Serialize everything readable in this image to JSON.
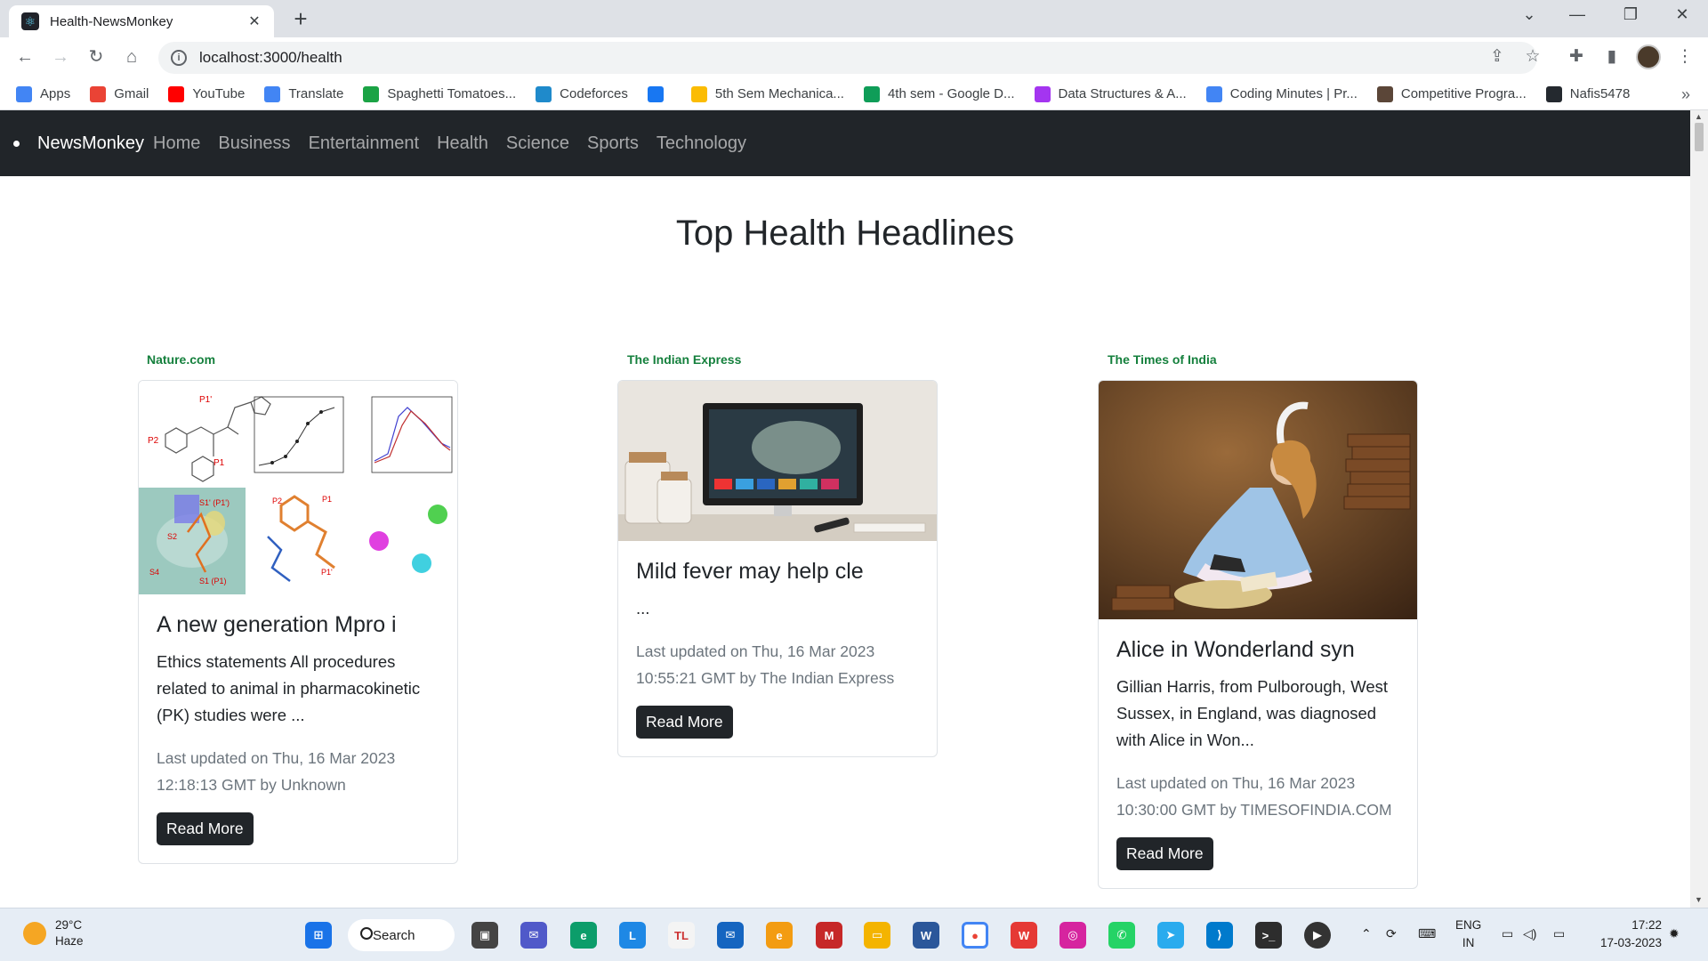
{
  "browser": {
    "tab_title": "Health-NewsMonkey",
    "tab_close": "✕",
    "new_tab": "+",
    "url": "localhost:3000/health",
    "bookmarks": [
      {
        "label": "Apps",
        "icon": "apps-grid-icon",
        "color": "#4285f4"
      },
      {
        "label": "Gmail",
        "icon": "gmail-icon",
        "color": "#ea4335"
      },
      {
        "label": "YouTube",
        "icon": "youtube-icon",
        "color": "#ff0000"
      },
      {
        "label": "Translate",
        "icon": "translate-icon",
        "color": "#4285f4"
      },
      {
        "label": "Spaghetti Tomatoes...",
        "icon": "px-icon",
        "color": "#1ba345"
      },
      {
        "label": "Codeforces",
        "icon": "codeforces-icon",
        "color": "#1f8acb"
      },
      {
        "label": "",
        "icon": "facebook-icon",
        "color": "#1877f2"
      },
      {
        "label": "5th Sem Mechanica...",
        "icon": "google-drive-icon",
        "color": "#fbbc04"
      },
      {
        "label": "4th sem - Google D...",
        "icon": "google-drive-icon",
        "color": "#0f9d58"
      },
      {
        "label": "Data Structures & A...",
        "icon": "udemy-icon",
        "color": "#a435f0"
      },
      {
        "label": "Coding Minutes | Pr...",
        "icon": "docs-icon",
        "color": "#4285f4"
      },
      {
        "label": "Competitive Progra...",
        "icon": "cc-icon",
        "color": "#5b4638"
      },
      {
        "label": "Nafis5478",
        "icon": "github-icon",
        "color": "#24292f"
      }
    ]
  },
  "app": {
    "brand": "NewsMonkey",
    "nav": [
      "Home",
      "Business",
      "Entertainment",
      "Health",
      "Science",
      "Sports",
      "Technology"
    ],
    "heading": "Top Health Headlines",
    "read_more": "Read More",
    "articles": [
      {
        "source": "Nature.com",
        "title": "A new generation Mpro i",
        "description": "Ethics statements All procedures related to animal in pharmacokinetic (PK) studies were ...",
        "meta_line1": "Last updated on Thu, 16 Mar 2023",
        "meta_line2": "12:18:13 GMT by Unknown"
      },
      {
        "source": "The Indian Express",
        "title": "Mild fever may help cle",
        "description": "...",
        "meta_line1": "Last updated on Thu, 16 Mar 2023",
        "meta_line2": "10:55:21 GMT by The Indian Express"
      },
      {
        "source": "The Times of India",
        "title": "Alice in Wonderland syn",
        "description": "Gillian Harris, from Pulborough, West Sussex, in England, was diagnosed with Alice in Won...",
        "meta_line1": "Last updated on Thu, 16 Mar 2023",
        "meta_line2": "10:30:00 GMT by TIMESOFINDIA.COM"
      }
    ]
  },
  "taskbar": {
    "temperature": "29°C",
    "weather": "Haze",
    "search": "Search",
    "lang_top": "ENG",
    "lang_bottom": "IN",
    "time": "17:22",
    "date": "17-03-2023"
  },
  "colors": {
    "navbar_bg": "#212529",
    "source_green": "#15803d",
    "button_bg": "#212529"
  }
}
